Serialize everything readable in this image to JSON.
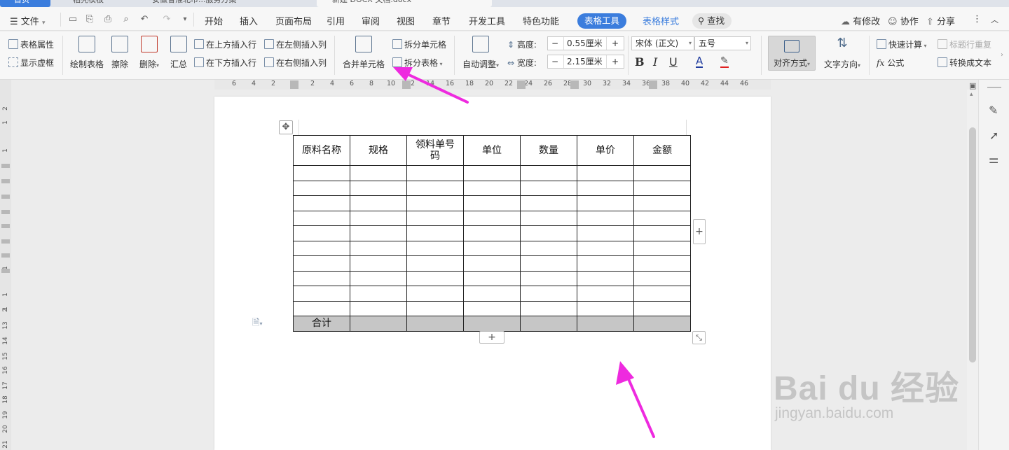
{
  "tabs": [
    {
      "label": "首页"
    },
    {
      "label": "稻壳模板"
    },
    {
      "label": "安徽省淮北市...服务方案"
    },
    {
      "label": "新建 DOCX 文档.docx"
    }
  ],
  "menu": {
    "file_label": "文件",
    "items": [
      "开始",
      "插入",
      "页面布局",
      "引用",
      "审阅",
      "视图",
      "章节",
      "开发工具",
      "特色功能"
    ],
    "table_tools": "表格工具",
    "table_style": "表格样式",
    "search": "查找",
    "right_items": [
      "有修改",
      "协作",
      "分享"
    ]
  },
  "ribbon": {
    "table_props": "表格属性",
    "show_gridlines": "显示虚框",
    "draw_table": "绘制表格",
    "erase": "擦除",
    "delete": "删除",
    "summary": "汇总",
    "insert_above": "在上方插入行",
    "insert_below": "在下方插入行",
    "insert_left": "在左侧插入列",
    "insert_right": "在右侧插入列",
    "merge_cells": "合并单元格",
    "split_cells": "拆分单元格",
    "split_table": "拆分表格",
    "auto_adjust": "自动调整",
    "height_label": "高度:",
    "height_value": "0.55厘米",
    "width_label": "宽度:",
    "width_value": "2.15厘米",
    "font_name": "宋体 (正文)",
    "font_size": "五号",
    "bold": "B",
    "italic": "I",
    "underline": "U",
    "font_color": "A",
    "align": "对齐方式",
    "text_direction": "文字方向",
    "quick_calc": "快速计算",
    "formula": "公式",
    "title_repeat": "标题行重复",
    "convert_text": "转换成文本"
  },
  "ruler_top": [
    "6",
    "4",
    "2",
    "2",
    "4",
    "6",
    "8",
    "10",
    "12",
    "14",
    "16",
    "18",
    "20",
    "22",
    "24",
    "26",
    "28",
    "30",
    "32",
    "34",
    "36",
    "38",
    "40",
    "42",
    "44",
    "46"
  ],
  "ruler_left": [
    "2",
    "1",
    "1",
    "1",
    "1",
    "1",
    "2",
    "13",
    "14",
    "15",
    "16",
    "17",
    "18",
    "19",
    "20",
    "21"
  ],
  "table": {
    "headers": [
      "原料名称",
      "规格",
      "领料单号码",
      "单位",
      "数量",
      "单价",
      "金额"
    ],
    "empty_rows": 10,
    "total_label": "合计"
  },
  "watermark": {
    "brand": "Bai du 经验",
    "url": "jingyan.baidu.com"
  },
  "colors": {
    "accent": "#3b7ddd",
    "arrow": "#ee2adf",
    "total_row": "#c6c6c6"
  }
}
